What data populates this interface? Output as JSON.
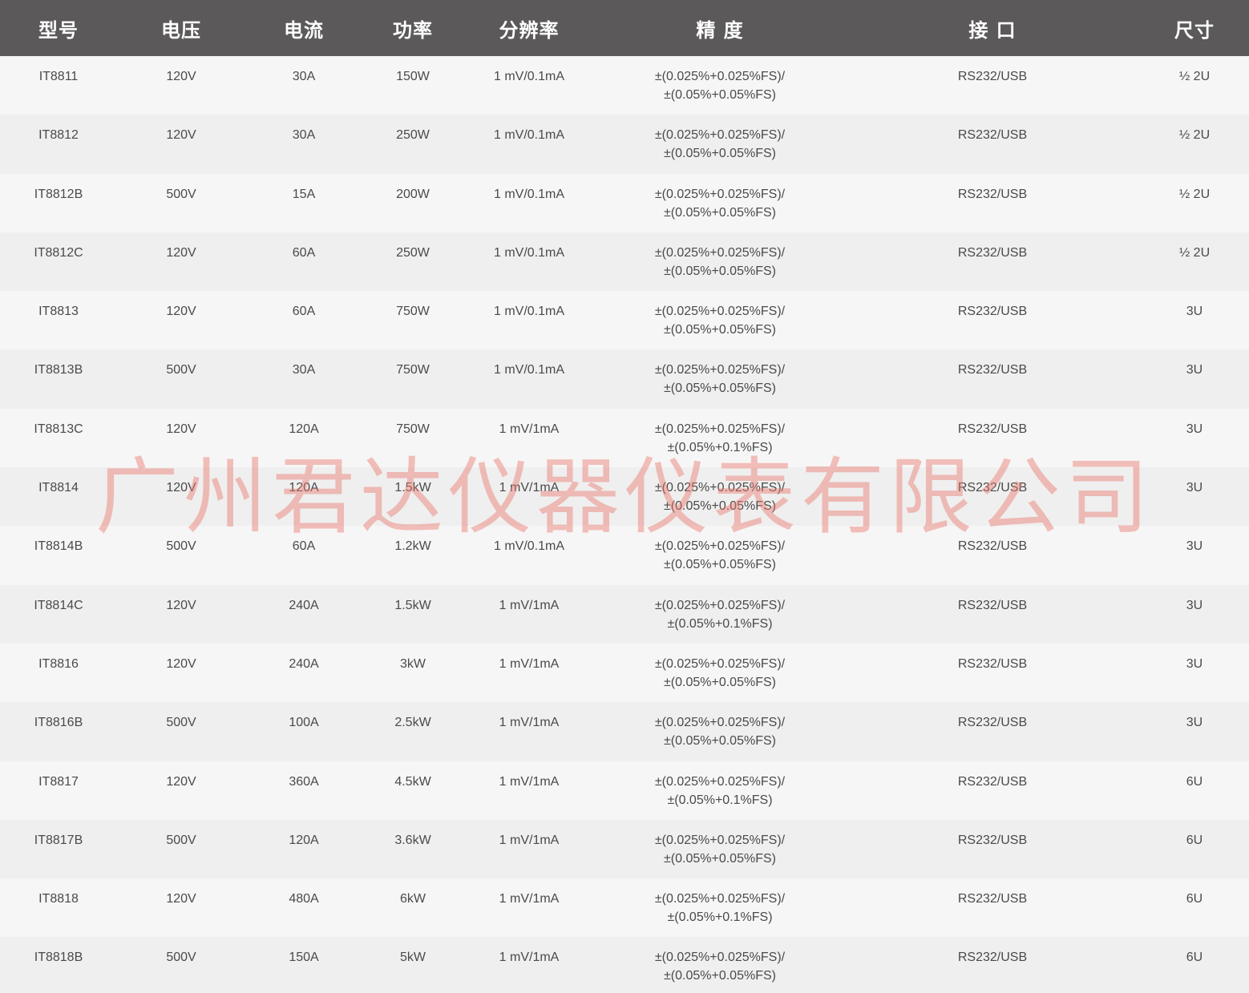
{
  "headers": [
    "型号",
    "电压",
    "电流",
    "功率",
    "分辨率",
    "精 度",
    "接 口",
    "尺寸"
  ],
  "rows": [
    [
      "IT8811",
      "120V",
      "30A",
      "150W",
      "1 mV/0.1mA",
      "±(0.025%+0.025%FS)/",
      "±(0.05%+0.05%FS)",
      "RS232/USB",
      "½ 2U"
    ],
    [
      "IT8812",
      "120V",
      "30A",
      "250W",
      "1 mV/0.1mA",
      "±(0.025%+0.025%FS)/",
      "±(0.05%+0.05%FS)",
      "RS232/USB",
      "½ 2U"
    ],
    [
      "IT8812B",
      "500V",
      "15A",
      "200W",
      "1 mV/0.1mA",
      "±(0.025%+0.025%FS)/",
      "±(0.05%+0.05%FS)",
      "RS232/USB",
      "½ 2U"
    ],
    [
      "IT8812C",
      "120V",
      "60A",
      "250W",
      "1 mV/0.1mA",
      "±(0.025%+0.025%FS)/",
      "±(0.05%+0.05%FS)",
      "RS232/USB",
      "½ 2U"
    ],
    [
      "IT8813",
      "120V",
      "60A",
      "750W",
      "1 mV/0.1mA",
      "±(0.025%+0.025%FS)/",
      "±(0.05%+0.05%FS)",
      "RS232/USB",
      "3U"
    ],
    [
      "IT8813B",
      "500V",
      "30A",
      "750W",
      "1 mV/0.1mA",
      "±(0.025%+0.025%FS)/",
      "±(0.05%+0.05%FS)",
      "RS232/USB",
      "3U"
    ],
    [
      "IT8813C",
      "120V",
      "120A",
      "750W",
      "1 mV/1mA",
      "±(0.025%+0.025%FS)/",
      "±(0.05%+0.1%FS)",
      "RS232/USB",
      "3U"
    ],
    [
      "IT8814",
      "120V",
      "120A",
      "1.5kW",
      "1 mV/1mA",
      "±(0.025%+0.025%FS)/",
      "±(0.05%+0.05%FS)",
      "RS232/USB",
      "3U"
    ],
    [
      "IT8814B",
      "500V",
      "60A",
      "1.2kW",
      "1 mV/0.1mA",
      "±(0.025%+0.025%FS)/",
      "±(0.05%+0.05%FS)",
      "RS232/USB",
      "3U"
    ],
    [
      "IT8814C",
      "120V",
      "240A",
      "1.5kW",
      "1 mV/1mA",
      "±(0.025%+0.025%FS)/",
      "±(0.05%+0.1%FS)",
      "RS232/USB",
      "3U"
    ],
    [
      "IT8816",
      "120V",
      "240A",
      "3kW",
      "1 mV/1mA",
      "±(0.025%+0.025%FS)/",
      "±(0.05%+0.05%FS)",
      "RS232/USB",
      "3U"
    ],
    [
      "IT8816B",
      "500V",
      "100A",
      "2.5kW",
      "1 mV/1mA",
      "±(0.025%+0.025%FS)/",
      "±(0.05%+0.05%FS)",
      "RS232/USB",
      "3U"
    ],
    [
      "IT8817",
      "120V",
      "360A",
      "4.5kW",
      "1 mV/1mA",
      "±(0.025%+0.025%FS)/",
      "±(0.05%+0.1%FS)",
      "RS232/USB",
      "6U"
    ],
    [
      "IT8817B",
      "500V",
      "120A",
      "3.6kW",
      "1 mV/1mA",
      "±(0.025%+0.025%FS)/",
      "±(0.05%+0.05%FS)",
      "RS232/USB",
      "6U"
    ],
    [
      "IT8818",
      "120V",
      "480A",
      "6kW",
      "1 mV/1mA",
      "±(0.025%+0.025%FS)/",
      "±(0.05%+0.1%FS)",
      "RS232/USB",
      "6U"
    ],
    [
      "IT8818B",
      "500V",
      "150A",
      "5kW",
      "1 mV/1mA",
      "±(0.025%+0.025%FS)/",
      "±(0.05%+0.05%FS)",
      "RS232/USB",
      "6U"
    ]
  ],
  "watermark": "广州君达仪器仪表有限公司",
  "colors": {
    "header_bg": "#5b595a",
    "header_text": "#ffffff",
    "row_odd": "#f6f6f6",
    "row_even": "#efefef",
    "watermark": "#ec786c"
  }
}
